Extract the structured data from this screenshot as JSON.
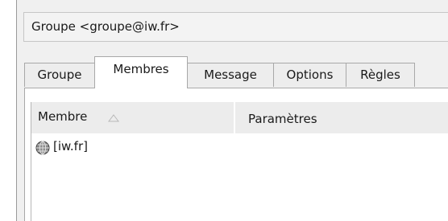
{
  "header": {
    "group_title": "Groupe <groupe@iw.fr>"
  },
  "tabs": [
    {
      "label": "Groupe",
      "active": false
    },
    {
      "label": "Membres",
      "active": true
    },
    {
      "label": "Message",
      "active": false
    },
    {
      "label": "Options",
      "active": false
    },
    {
      "label": "Règles",
      "active": false
    }
  ],
  "members_list": {
    "columns": [
      {
        "label": "Membre",
        "sort": "ascending"
      },
      {
        "label": "Paramètres"
      }
    ],
    "rows": [
      {
        "icon": "globe-icon",
        "member": "[iw.fr]",
        "params": ""
      }
    ]
  },
  "colors": {
    "window_bg": "#f0f0f0",
    "panel_bg": "#ffffff",
    "header_bg": "#ececec",
    "border": "#a8a8a8"
  }
}
